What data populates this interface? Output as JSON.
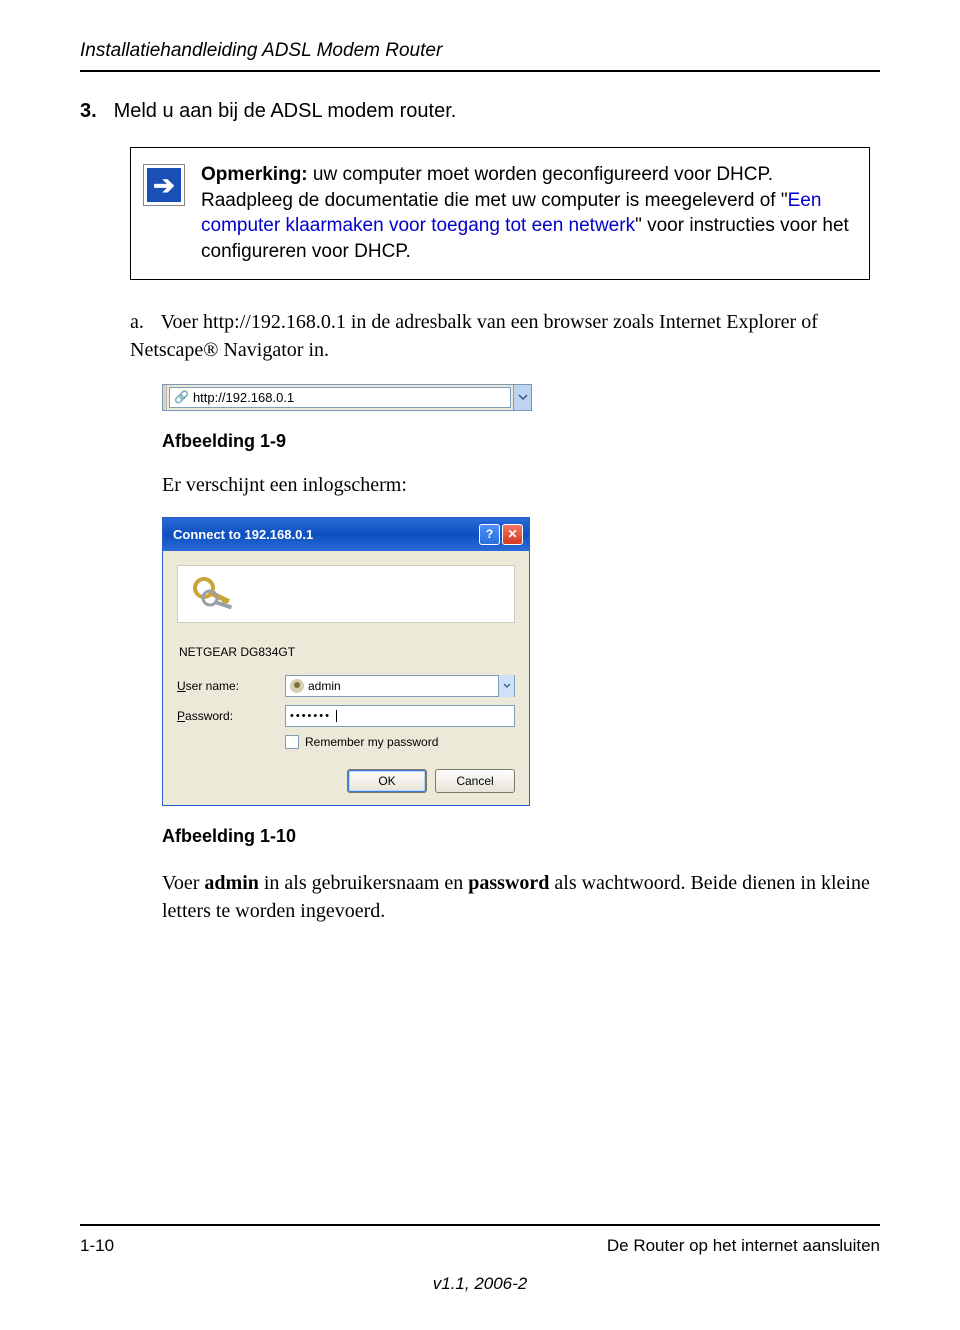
{
  "header": {
    "title": "Installatiehandleiding ADSL Modem Router"
  },
  "step": {
    "number": "3.",
    "text": "Meld u aan bij de ADSL modem router."
  },
  "note": {
    "label": "Opmerking:",
    "text_before_link": " uw computer moet worden geconfigureerd voor DHCP. Raadpleeg de documentatie die met uw computer is meegeleverd of \"",
    "link_text": "Een computer klaarmaken voor toegang tot een netwerk",
    "text_after_link": "\" voor instructies voor het configureren voor DHCP."
  },
  "substep": {
    "letter": "a.",
    "text": "Voer http://192.168.0.1 in de adresbalk van een browser zoals Internet Explorer of Netscape® Navigator in."
  },
  "addressbar": {
    "url": "http://192.168.0.1"
  },
  "caption1": "Afbeelding 1-9",
  "line1": "Er verschijnt een inlogscherm:",
  "dialog": {
    "title": "Connect to 192.168.0.1",
    "app_name": "NETGEAR DG834GT",
    "user_label_pre": "U",
    "user_label_rest": "ser name:",
    "user_value": "admin",
    "pass_label_pre": "P",
    "pass_label_rest": "assword:",
    "pass_value": "•••••••",
    "remember_pre": "R",
    "remember_rest": "emember my password",
    "ok": "OK",
    "cancel": "Cancel"
  },
  "caption2": "Afbeelding 1-10",
  "after": {
    "prefix": "Voer ",
    "bold1": "admin",
    "mid": " in als gebruikersnaam en ",
    "bold2": "password",
    "suffix": " als wachtwoord. Beide dienen in kleine letters te worden ingevoerd."
  },
  "footer": {
    "left": "1-10",
    "right": "De Router op het internet aansluiten",
    "center": "v1.1, 2006-2"
  }
}
